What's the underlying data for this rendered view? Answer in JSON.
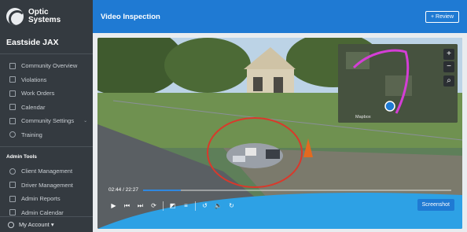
{
  "brand": {
    "line1": "Optic",
    "line2": "Systems"
  },
  "org_name": "Eastside JAX",
  "nav": [
    {
      "label": "Community Overview",
      "icon": "dashboard-icon"
    },
    {
      "label": "Violations",
      "icon": "list-icon"
    },
    {
      "label": "Work Orders",
      "icon": "tools-icon"
    },
    {
      "label": "Calendar",
      "icon": "calendar-icon"
    },
    {
      "label": "Community Settings",
      "icon": "gear-icon",
      "chevron": "⌄"
    },
    {
      "label": "Training",
      "icon": "help-icon"
    }
  ],
  "admin_section": {
    "title": "Admin Tools"
  },
  "admin_nav": [
    {
      "label": "Client Management",
      "icon": "gear-icon"
    },
    {
      "label": "Driver Management",
      "icon": "car-icon"
    },
    {
      "label": "Admin Reports",
      "icon": "report-icon"
    },
    {
      "label": "Admin Calendar",
      "icon": "calendar-icon"
    }
  ],
  "account": {
    "label": "My Account ▾"
  },
  "header": {
    "title": "Video Inspection",
    "review_label": "+ Review"
  },
  "player": {
    "time": "02:44 / 22:27",
    "progress": 0.122,
    "screenshot_label": "Screenshot"
  },
  "map": {
    "zoom_in": "+",
    "zoom_out": "−",
    "search": "⌕",
    "watermark": "Mapbox"
  },
  "colors": {
    "accent": "#1f7ad3",
    "sidebar": "#343a40",
    "highlight_circle": "#d9392b",
    "route": "#d43ed6"
  }
}
